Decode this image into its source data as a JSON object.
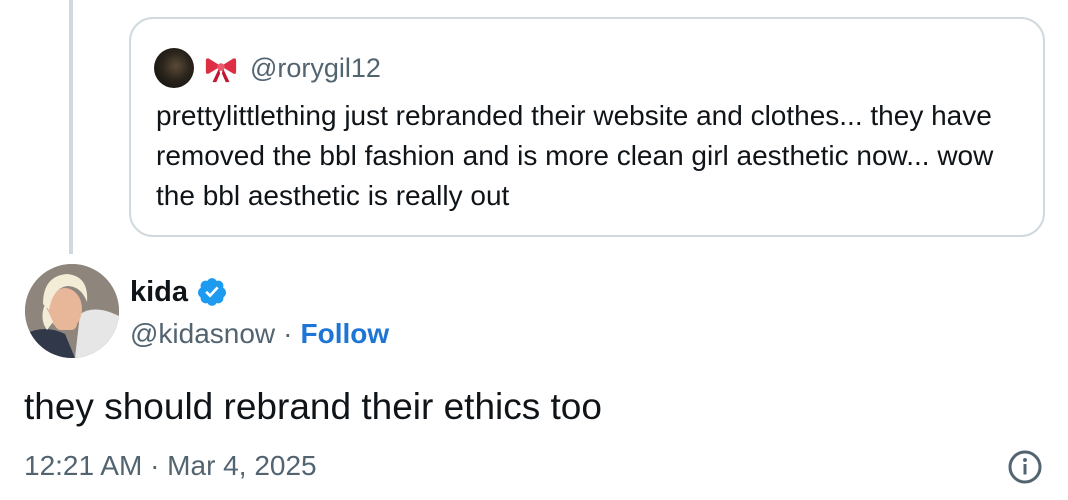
{
  "quoted_tweet": {
    "handle": "@rorygil12",
    "avatar_icon": "profile-photo-dark",
    "emoji_icon": "red-bow-icon",
    "text": "prettylittlething just rebranded their website and clothes... they have removed  the bbl fashion and is more clean girl aesthetic now... wow the bbl aesthetic is really out"
  },
  "author": {
    "name": "kida",
    "handle": "@kidasnow",
    "separator": "·",
    "follow_label": "Follow",
    "verified_icon": "verified-badge-icon"
  },
  "tweet": {
    "text": "they should rebrand their ethics too",
    "timestamp": "12:21 AM · Mar 4, 2025"
  },
  "colors": {
    "link": "#1d75d6",
    "verified": "#1d9bf0",
    "secondary_text": "#536471",
    "border": "#cfd9de"
  }
}
